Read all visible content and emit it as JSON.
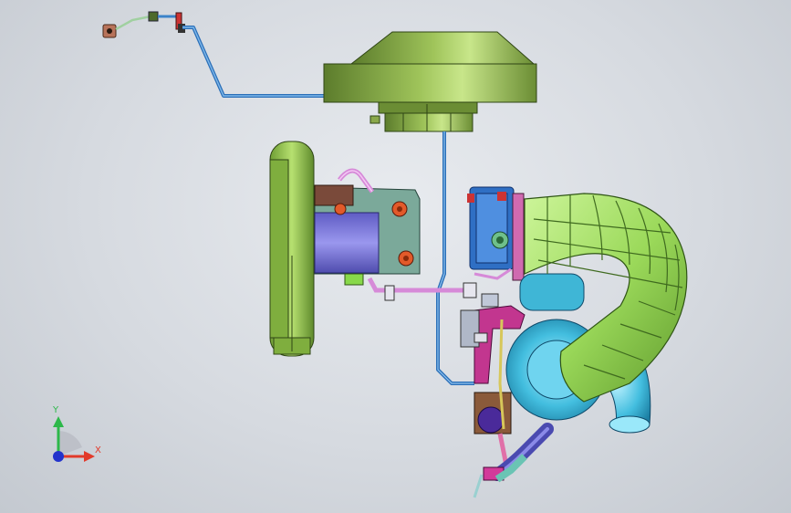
{
  "triad": {
    "x_label": "X",
    "y_label": "Y",
    "x_color": "#e23a2a",
    "y_color": "#2db84a",
    "z_color": "#2233cc"
  },
  "colors": {
    "background": "#d9dde2",
    "hood_green": "#8db04a",
    "flywheel_green": "#9acb54",
    "bracket_teal": "#7ba99a",
    "motor_purple": "#7a77d8",
    "pipe_blue": "#3b83c9",
    "pipe_pink": "#d68ad8",
    "turbo_cyan": "#3fb6d6",
    "intake_green": "#a8e06a",
    "actuator_magenta": "#c2368f",
    "flange_blue": "#2f6fc4"
  },
  "icons": [
    "coordinate-triad-icon"
  ]
}
